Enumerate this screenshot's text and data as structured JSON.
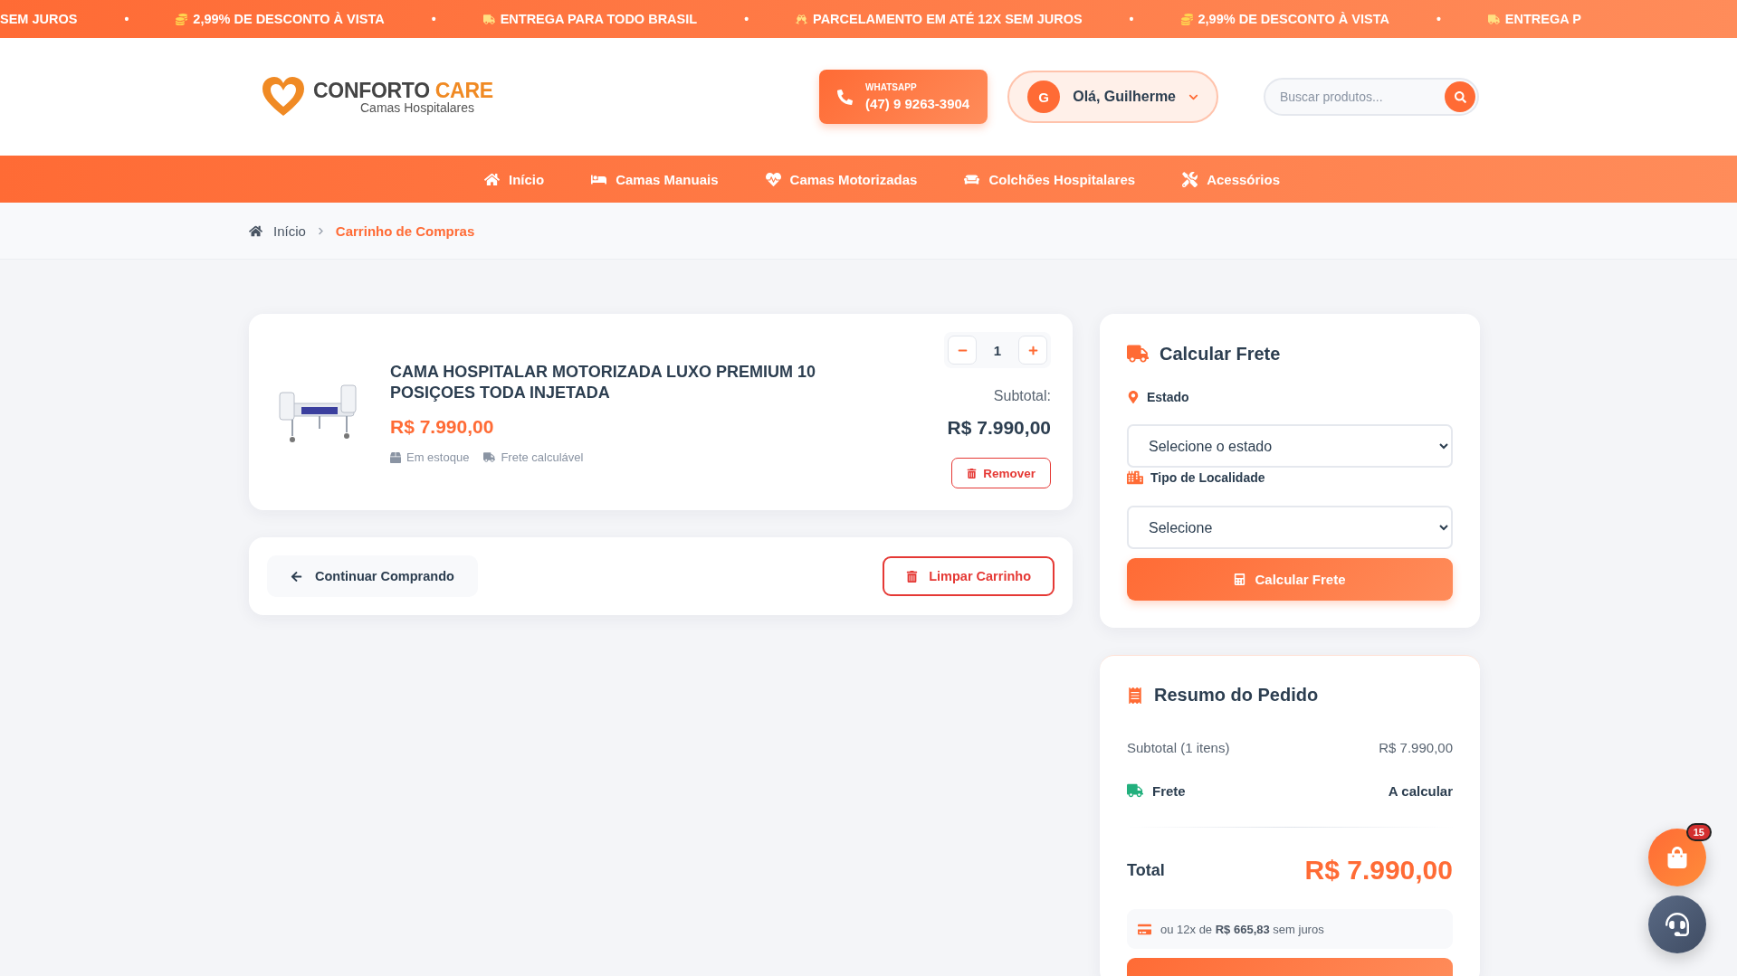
{
  "ticker": {
    "separator": "•",
    "items": [
      {
        "text": "SEM JUROS"
      },
      {
        "text": "2,99% DE DESCONTO À VISTA"
      },
      {
        "text": "ENTREGA PARA TODO BRASIL"
      },
      {
        "text": "PARCELAMENTO EM ATÉ 12X SEM JUROS"
      },
      {
        "text": "2,99% DE DESCONTO À VISTA"
      },
      {
        "text": "ENTREGA P"
      }
    ]
  },
  "header": {
    "logo": {
      "brand_dark": "CONFORTO",
      "brand_accent": "CARE",
      "tagline": "Camas Hospitalares"
    },
    "whatsapp": {
      "label": "WHATSAPP",
      "number": "(47) 9 9263-3904"
    },
    "user": {
      "initial": "G",
      "greeting": "Olá, Guilherme"
    },
    "search": {
      "placeholder": "Buscar produtos..."
    }
  },
  "nav": [
    {
      "label": "Início"
    },
    {
      "label": "Camas Manuais"
    },
    {
      "label": "Camas Motorizadas"
    },
    {
      "label": "Colchões Hospitalares"
    },
    {
      "label": "Acessórios"
    }
  ],
  "breadcrumb": [
    {
      "label": "Início",
      "current": false
    },
    {
      "label": "Carrinho de Compras",
      "current": true
    }
  ],
  "cart_items": [
    {
      "name": "CAMA HOSPITALAR MOTORIZADA LUXO PREMIUM 10 POSIÇOES TODA INJETADA",
      "price": "R$ 7.990,00",
      "stock": "Em estoque",
      "shipping": "Frete calculável",
      "quantity": "1",
      "subtotal_label": "Subtotal:",
      "subtotal": "R$ 7.990,00",
      "remove": "Remover"
    }
  ],
  "actions": {
    "continue": "Continuar Comprando",
    "clear": "Limpar Carrinho"
  },
  "freight": {
    "title": "Calcular Frete",
    "state_label": "Estado",
    "state_value": "Selecione o estado",
    "locality_label": "Tipo de Localidade",
    "locality_value": "Selecione",
    "button": "Calcular Frete"
  },
  "summary": {
    "title": "Resumo do Pedido",
    "rows": [
      {
        "kind": "subtotal",
        "label": "Subtotal (1 itens)",
        "value": "R$ 7.990,00"
      },
      {
        "kind": "shipping",
        "label": "Frete",
        "value": "A calcular"
      }
    ],
    "total_label": "Total",
    "total": "R$ 7.990,00",
    "installments": "ou 12x de **R$ 665,83** sem juros"
  },
  "floating": {
    "cart_count": "15"
  }
}
